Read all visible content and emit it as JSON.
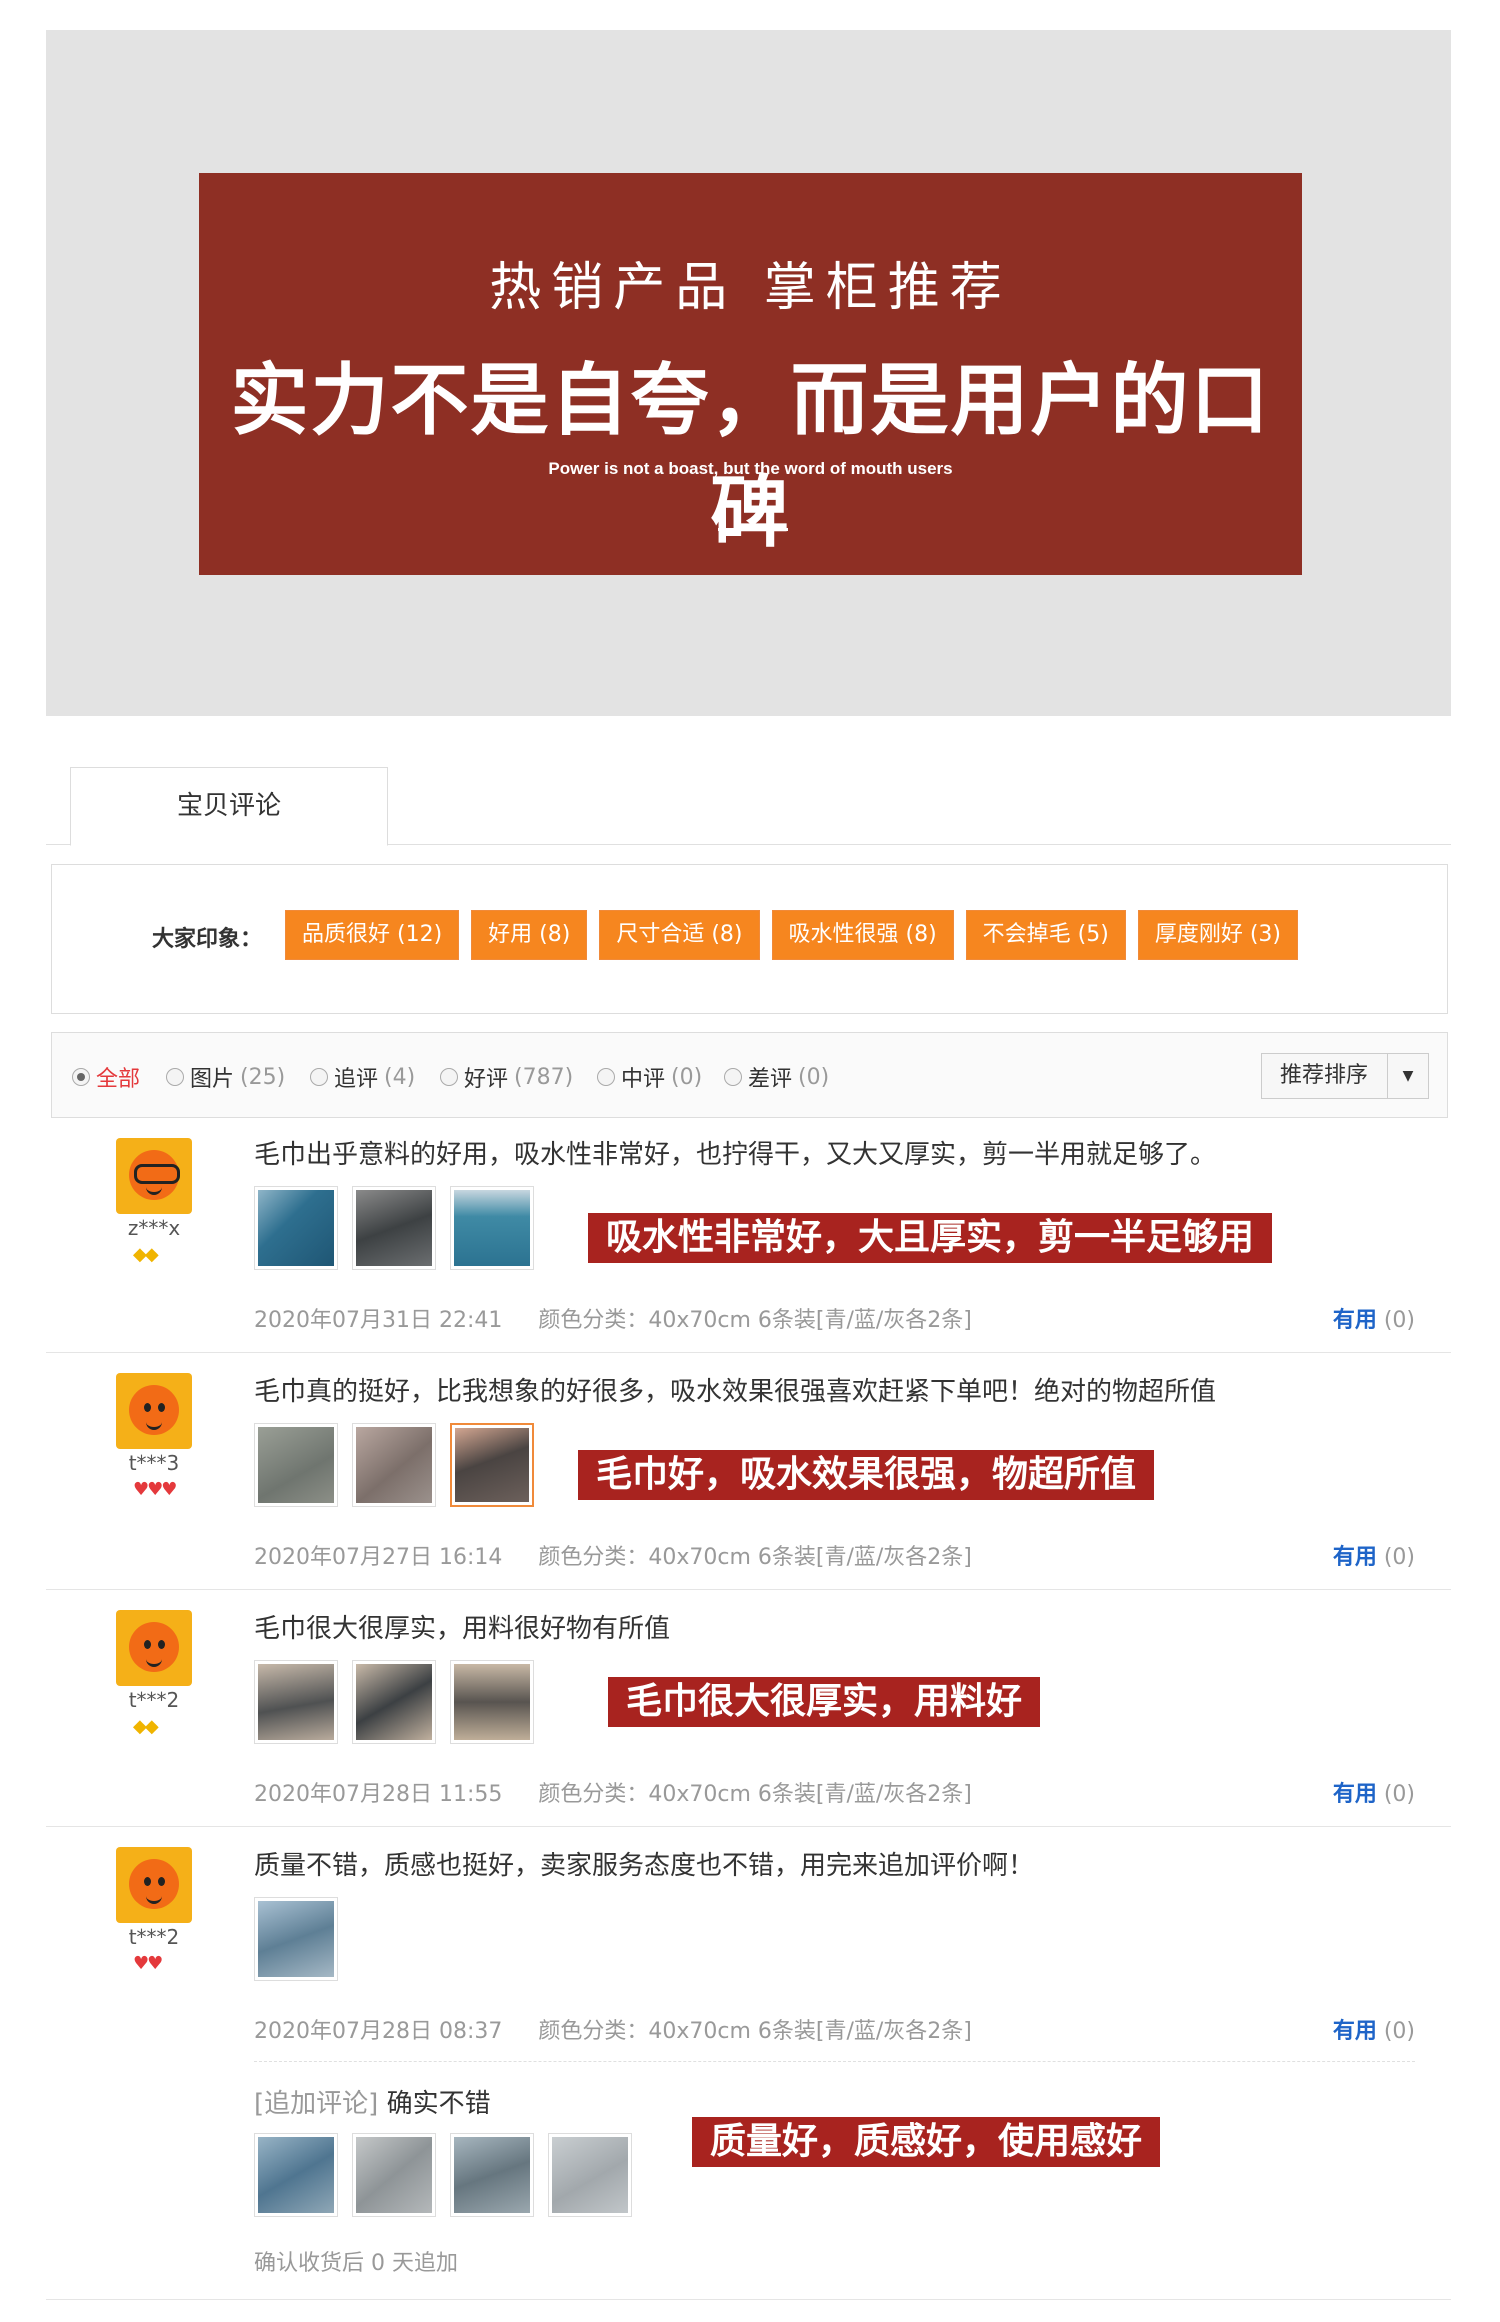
{
  "banner": {
    "title_line1": "热销产品 掌柜推荐",
    "title_line2": "实力不是自夸，而是用户的口碑",
    "subtitle_en": "Power is not a boast, but the word of mouth users"
  },
  "tabs": [
    {
      "label": "宝贝评论"
    }
  ],
  "impressions": {
    "label": "大家印象：",
    "tags": [
      {
        "label": "品质很好 (12)"
      },
      {
        "label": "好用 (8)"
      },
      {
        "label": "尺寸合适 (8)"
      },
      {
        "label": "吸水性很强 (8)"
      },
      {
        "label": "不会掉毛 (5)"
      },
      {
        "label": "厚度刚好 (3)"
      }
    ]
  },
  "filters": {
    "items": [
      {
        "label": "全部",
        "count": "",
        "selected": true
      },
      {
        "label": "图片",
        "count": "(25)"
      },
      {
        "label": "追评",
        "count": "(4)"
      },
      {
        "label": "好评",
        "count": "(787)"
      },
      {
        "label": "中评",
        "count": "(0)"
      },
      {
        "label": "差评",
        "count": "(0)"
      }
    ],
    "sort_label": "推荐排序",
    "sort_icon": "caret-down-icon"
  },
  "colors": {
    "banner_bg": "#8e2f24",
    "tag_bg": "#f6861f",
    "callout_bg": "#a8231f",
    "useful_link": "#1e64c8",
    "selected_filter": "#e4393c"
  },
  "reviews": [
    {
      "user": "z***x",
      "rank_icon": "gold-diamond-icon",
      "text": "毛巾出乎意料的好用，吸水性非常好，也拧得干，又大又厚实，剪一半用就足够了。",
      "callout": "吸水性非常好，大且厚实，剪一半足够用",
      "date": "2020年07月31日 22:41",
      "attr": "颜色分类：40x70cm 6条装[青/蓝/灰各2条]",
      "useful_label": "有用",
      "useful_count": "(0)"
    },
    {
      "user": "t***3",
      "rank_icon": "red-heart-icon",
      "text": "毛巾真的挺好，比我想象的好很多，吸水效果很强喜欢赶紧下单吧！绝对的物超所值",
      "callout": "毛巾好，吸水效果很强，物超所值",
      "date": "2020年07月27日 16:14",
      "attr": "颜色分类：40x70cm 6条装[青/蓝/灰各2条]",
      "useful_label": "有用",
      "useful_count": "(0)"
    },
    {
      "user": "t***2",
      "rank_icon": "gold-diamond-icon",
      "text": "毛巾很大很厚实，用料很好物有所值",
      "callout": "毛巾很大很厚实，用料好",
      "date": "2020年07月28日 11:55",
      "attr": "颜色分类：40x70cm 6条装[青/蓝/灰各2条]",
      "useful_label": "有用",
      "useful_count": "(0)"
    },
    {
      "user": "t***2",
      "rank_icon": "red-heart-icon",
      "text": "质量不错，质感也挺好，卖家服务态度也不错，用完来追加评价啊！",
      "date": "2020年07月28日 08:37",
      "attr": "颜色分类：40x70cm 6条装[青/蓝/灰各2条]",
      "useful_label": "有用",
      "useful_count": "(0)",
      "append_tag": "[追加评论]",
      "append_text": "确实不错",
      "callout": "质量好，质感好，使用感好",
      "append_footnote": "确认收货后 0 天追加"
    }
  ]
}
